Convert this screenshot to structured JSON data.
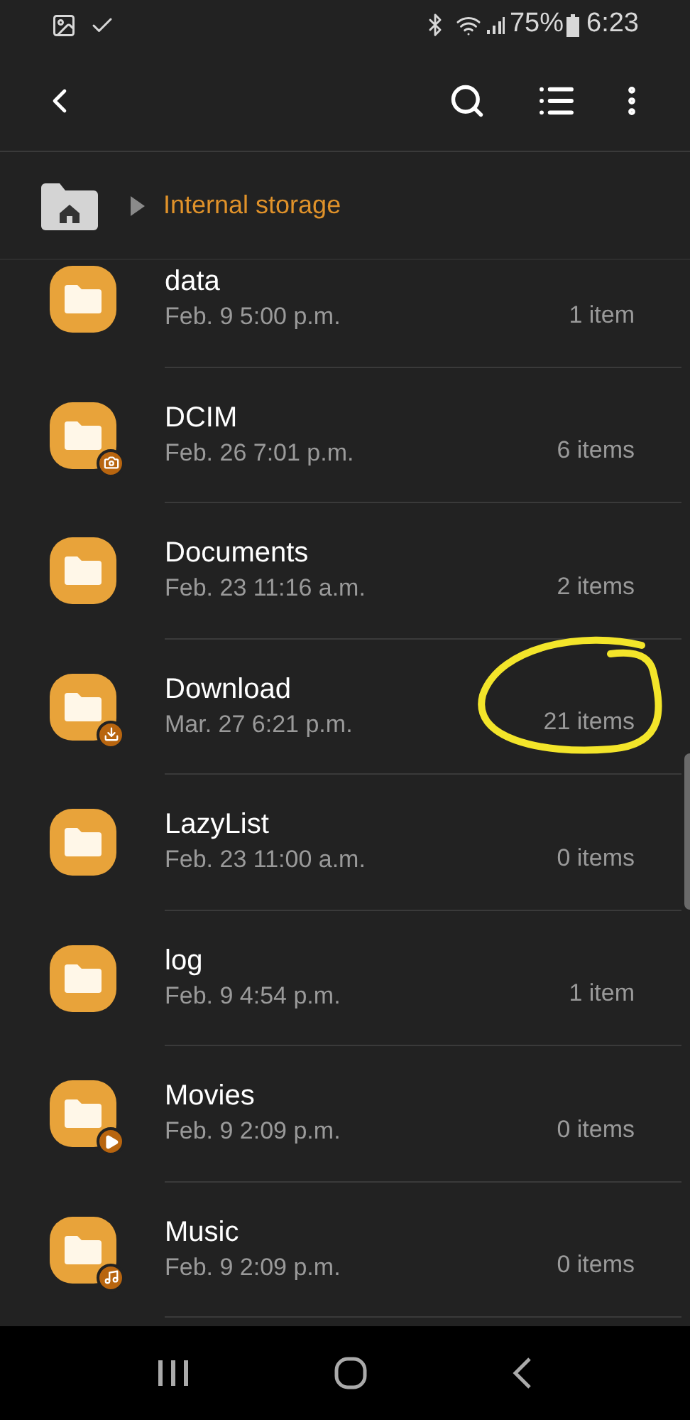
{
  "status_bar": {
    "battery": "75%",
    "time": "6:23"
  },
  "breadcrumb": {
    "label": "Internal storage"
  },
  "folders": [
    {
      "name": "data",
      "date": "Feb. 9 5:00 p.m.",
      "count": "1 item",
      "kind": "plain",
      "circled": false
    },
    {
      "name": "DCIM",
      "date": "Feb. 26 7:01 p.m.",
      "count": "6 items",
      "kind": "camera",
      "circled": false
    },
    {
      "name": "Documents",
      "date": "Feb. 23 11:16 a.m.",
      "count": "2 items",
      "kind": "plain",
      "circled": false
    },
    {
      "name": "Download",
      "date": "Mar. 27 6:21 p.m.",
      "count": "21 items",
      "kind": "download",
      "circled": true
    },
    {
      "name": "LazyList",
      "date": "Feb. 23 11:00 a.m.",
      "count": "0 items",
      "kind": "plain",
      "circled": false
    },
    {
      "name": "log",
      "date": "Feb. 9 4:54 p.m.",
      "count": "1 item",
      "kind": "plain",
      "circled": false
    },
    {
      "name": "Movies",
      "date": "Feb. 9 2:09 p.m.",
      "count": "0 items",
      "kind": "play",
      "circled": false
    },
    {
      "name": "Music",
      "date": "Feb. 9 2:09 p.m.",
      "count": "0 items",
      "kind": "music",
      "circled": false
    }
  ]
}
